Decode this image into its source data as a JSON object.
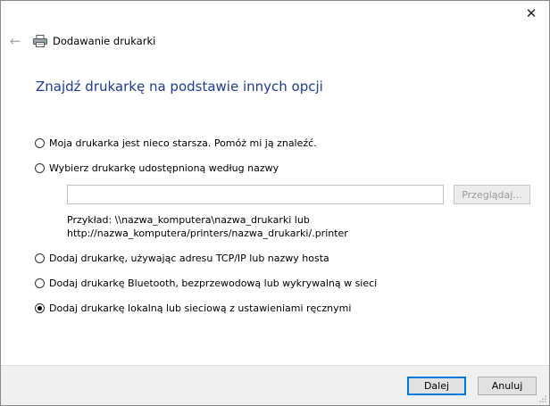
{
  "window": {
    "close_glyph": "✕",
    "back_glyph": "←",
    "title": "Dodawanie drukarki"
  },
  "heading": "Znajdź drukarkę na podstawie innych opcji",
  "options": [
    {
      "label": "Moja drukarka jest nieco starsza. Pomóż mi ją znaleźć.",
      "checked": false
    },
    {
      "label": "Wybierz drukarkę udostępnioną według nazwy",
      "checked": false
    },
    {
      "label": "Dodaj drukarkę, używając adresu TCP/IP lub nazwy hosta",
      "checked": false
    },
    {
      "label": "Dodaj drukarkę Bluetooth, bezprzewodową lub wykrywalną w sieci",
      "checked": false
    },
    {
      "label": "Dodaj drukarkę lokalną lub sieciową z ustawieniami ręcznymi",
      "checked": true
    }
  ],
  "shared_name": {
    "value": "",
    "browse_label": "Przeglądaj...",
    "example_line1": "Przykład: \\\\nazwa_komputera\\nazwa_drukarki lub",
    "example_line2": "http://nazwa_komputera/printers/nazwa_drukarki/.printer"
  },
  "footer": {
    "next_label": "Dalej",
    "cancel_label": "Anuluj"
  },
  "colors": {
    "heading": "#1e3b9a",
    "default_button_border": "#0078d7"
  }
}
